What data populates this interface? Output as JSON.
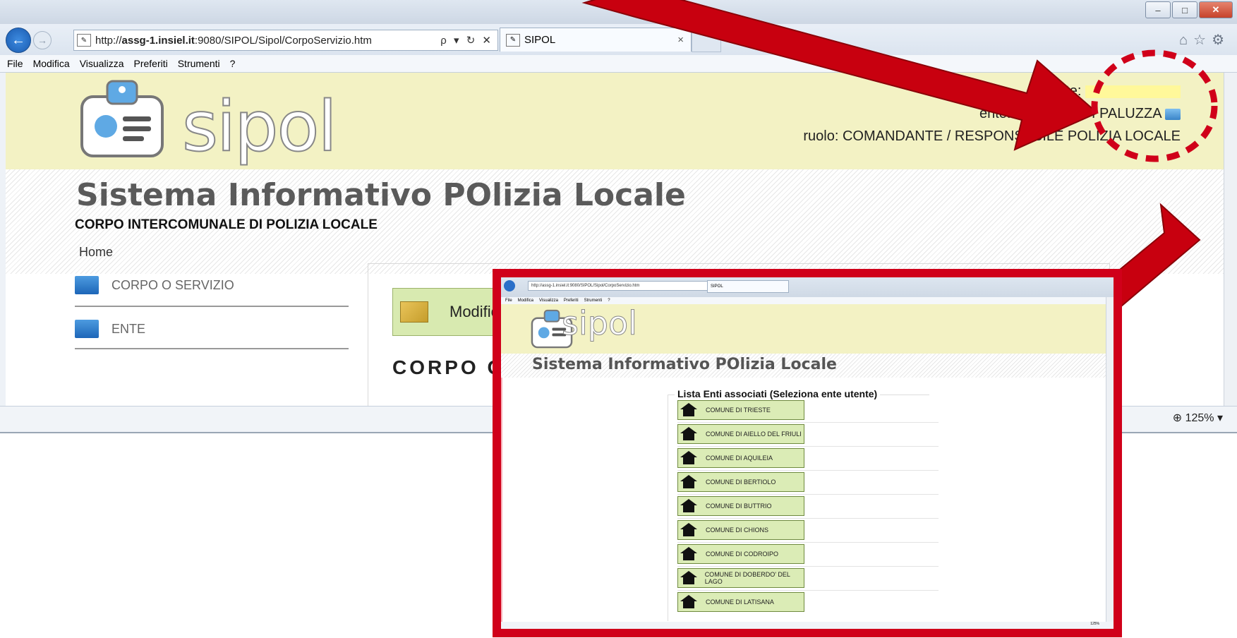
{
  "browser": {
    "url_prefix": "http://",
    "url_host": "assg-1.insiel.it",
    "url_rest": ":9080/SIPOL/Sipol/CorpoServizio.htm",
    "address_tools": "ρ ▾ ↻ ✕",
    "tab_title": "SIPOL",
    "tab_close": "×",
    "menu": [
      "File",
      "Modifica",
      "Visualizza",
      "Preferiti",
      "Strumenti",
      "?"
    ],
    "zoom": "125%",
    "window_controls": [
      "–",
      "□",
      "✕"
    ]
  },
  "header": {
    "logo_text": "sipol",
    "utente_label": "utente:",
    "ente_label": "ente: COMUNE DI PALUZZA",
    "ruolo_label": "ruolo: COMANDANTE / RESPONSABILE POLIZIA LOCALE"
  },
  "main": {
    "system_name": "Sistema Informativo POlizia Locale",
    "corpo_title": "CORPO INTERCOMUNALE DI POLIZIA LOCALE",
    "breadcrumb_home": "Home",
    "sidebar": [
      {
        "label": "CORPO O SERVIZIO"
      },
      {
        "label": "ENTE"
      }
    ],
    "modify_label": "Modific",
    "section_partial": "CORPO O SE"
  },
  "inset": {
    "url": "http://assg-1.insiel.it:9080/SIPOL/Sipol/CorpoServizio.htm",
    "tab": "SIPOL",
    "menu": [
      "File",
      "Modifica",
      "Visualizza",
      "Preferiti",
      "Strumenti",
      "?"
    ],
    "logo_text": "sipol",
    "system_name": "Sistema Informativo POlizia Locale",
    "list_title": "Lista Enti associati (Seleziona ente utente)",
    "enti": [
      "COMUNE DI TRIESTE",
      "COMUNE DI AIELLO DEL FRIULI",
      "COMUNE DI AQUILEIA",
      "COMUNE DI BERTIOLO",
      "COMUNE DI BUTTRIO",
      "COMUNE DI CHIONS",
      "COMUNE DI CODROIPO",
      "COMUNE DI DOBERDO' DEL LAGO",
      "COMUNE DI LATISANA"
    ],
    "zoom": "125%"
  },
  "colors": {
    "header_bg": "#f3f2c4",
    "annotation_red": "#d0001a",
    "button_green": "#dbecb6"
  }
}
